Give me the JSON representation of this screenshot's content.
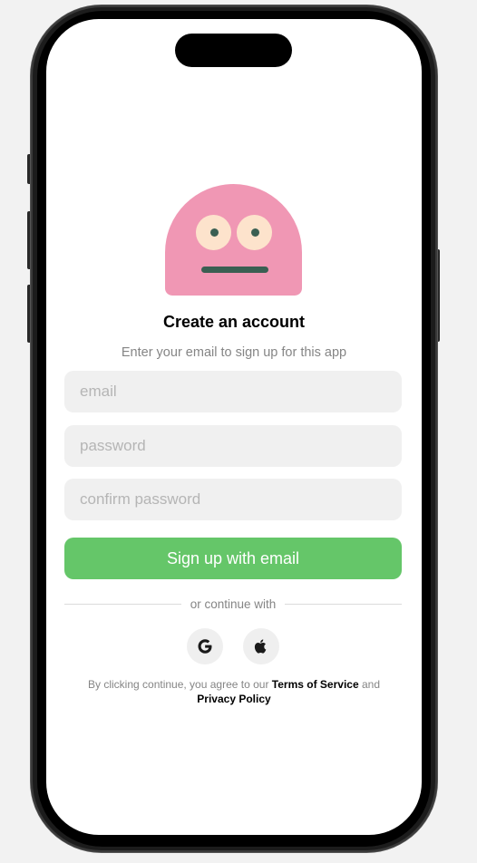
{
  "signup": {
    "title": "Create an account",
    "subtitle": "Enter your email to sign up for this app",
    "email_placeholder": "email",
    "password_placeholder": "password",
    "confirm_password_placeholder": "confirm password",
    "submit_label": "Sign up with email",
    "divider_text": "or continue with"
  },
  "social": {
    "google_icon": "google-icon",
    "apple_icon": "apple-icon"
  },
  "legal": {
    "prefix": "By clicking continue, you agree to our",
    "terms_link": "Terms of Service",
    "conjunction": "and",
    "privacy_link": "Privacy Policy"
  },
  "colors": {
    "accent_green": "#65c669",
    "mascot_pink": "#f097b4",
    "mascot_eye": "#fde3cc",
    "mascot_feature": "#3a5f52",
    "field_bg": "#f0f0f0"
  }
}
